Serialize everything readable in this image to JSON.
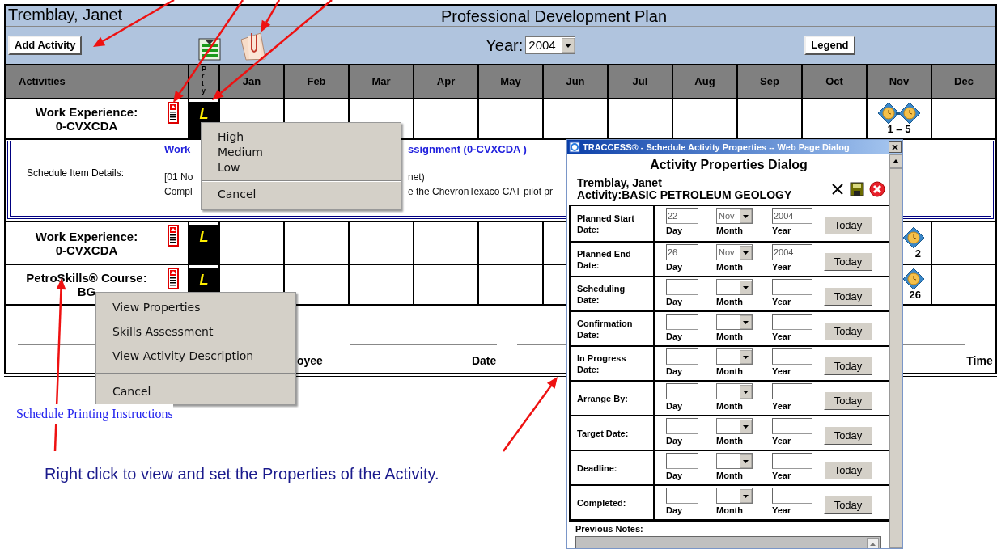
{
  "page": {
    "employee": "Tremblay, Janet",
    "title": "Professional Development Plan"
  },
  "toolbar": {
    "add_button": "Add Activity",
    "year_label": "Year:",
    "year": "2004",
    "legend_button": "Legend"
  },
  "columns": [
    "Activities",
    "Prty",
    "Jan",
    "Feb",
    "Mar",
    "Apr",
    "May",
    "Jun",
    "Jul",
    "Aug",
    "Sep",
    "Oct",
    "Nov",
    "Dec"
  ],
  "rows": [
    {
      "name": "Work Experience:",
      "code": "0-CVXCDA",
      "priority": "L",
      "nov_marker": {
        "kind": "range",
        "label": "1 – 5"
      }
    },
    {
      "kind": "details",
      "label": "Schedule Item Details:",
      "lines": [
        {
          "kind": "link",
          "before": "Work",
          "after": "ssignment (0-CVXCDA )"
        },
        {
          "kind": "text",
          "before": "[01 No",
          "after": "net)"
        },
        {
          "kind": "text",
          "before": "Compl",
          "after": "e the ChevronTexaco CAT pilot pr"
        }
      ]
    },
    {
      "name": "Work Experience:",
      "code": "0-CVXCDA",
      "priority": "L",
      "nov_marker": {
        "kind": "partial",
        "label": "2"
      }
    },
    {
      "name": "PetroSkills® Course:",
      "code": "BG",
      "priority": "L",
      "nov_marker": {
        "kind": "partial",
        "label": "26"
      }
    }
  ],
  "signature": [
    "oyee",
    "Date",
    "Time"
  ],
  "print_link": "Schedule Printing Instructions",
  "caption": "Right click to view and set the Properties of the Activity.",
  "priority_menu": {
    "items": [
      "High",
      "Medium",
      "Low"
    ],
    "cancel": "Cancel"
  },
  "context_menu": {
    "items": [
      "View Properties",
      "Skills Assessment",
      "View Activity Description"
    ],
    "cancel": "Cancel"
  },
  "dialog": {
    "title": "TRACCESS® - Schedule Activity Properties -- Web Page Dialog",
    "heading": "Activity Properties Dialog",
    "employee": "Tremblay, Janet",
    "activity": "Activity:BASIC PETROLEUM GEOLOGY",
    "date_rows": [
      {
        "label": "Planned Start Date:",
        "day": "22",
        "month": "Nov",
        "year": "2004",
        "day_label": "Day",
        "month_label": "Month",
        "year_label": "Year",
        "button": "Today"
      },
      {
        "label": "Planned End Date:",
        "day": "26",
        "month": "Nov",
        "year": "2004",
        "day_label": "Day",
        "month_label": "Month",
        "year_label": "Year",
        "button": "Today"
      },
      {
        "label": "Scheduling Date:",
        "day_label": "Day",
        "month_label": "Month",
        "year_label": "Year",
        "button": "Today"
      },
      {
        "label": "Confirmation Date:",
        "day_label": "Day",
        "month_label": "Month",
        "year_label": "Year",
        "button": "Today"
      },
      {
        "label": "In Progress Date:",
        "day_label": "Day",
        "month_label": "Month",
        "year_label": "Year",
        "button": "Today"
      },
      {
        "label": "Arrange By:",
        "day_label": "Day",
        "month_label": "Month",
        "year_label": "Year",
        "button": "Today"
      },
      {
        "label": "Target Date:",
        "day_label": "Day",
        "month_label": "Month",
        "year_label": "Year",
        "button": "Today"
      },
      {
        "label": "Deadline:",
        "day_label": "Day",
        "month_label": "Month",
        "year_label": "Year",
        "button": "Today"
      },
      {
        "label": "Completed:",
        "day_label": "Day",
        "month_label": "Month",
        "year_label": "Year",
        "button": "Today"
      }
    ],
    "notes_label": "Previous Notes:"
  }
}
